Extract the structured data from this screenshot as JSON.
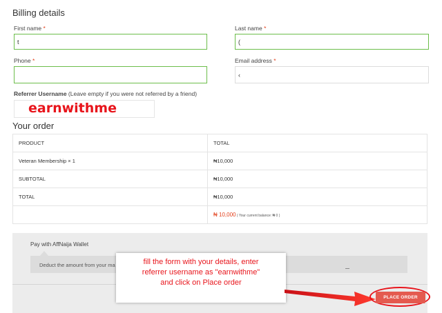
{
  "billing": {
    "title": "Billing details",
    "first_name": {
      "label": "First name",
      "required_mark": "*",
      "value": "t"
    },
    "last_name": {
      "label": "Last name",
      "required_mark": "*",
      "value": "("
    },
    "phone": {
      "label": "Phone",
      "required_mark": "*",
      "value": ""
    },
    "email": {
      "label": "Email address",
      "required_mark": "*",
      "value": "‹"
    },
    "referrer": {
      "label_bold": "Referrer Username",
      "label_hint": " (Leave empty if you were not referred by a friend)",
      "value": "earnwithme"
    }
  },
  "order": {
    "title": "Your order",
    "headers": [
      "PRODUCT",
      "TOTAL"
    ],
    "rows": [
      {
        "product": "Veteran Membership",
        "qty": " × 1",
        "total": "₦10,000"
      },
      {
        "product": "SUBTOTAL",
        "total": "₦10,000"
      },
      {
        "product": "TOTAL",
        "total": "₦10,000"
      }
    ],
    "wallet_total": "₦ 10,000",
    "wallet_balance": " ( Your current balance: ₦ 0 )"
  },
  "payment": {
    "method_label": "Pay with AffNaija Wallet",
    "description": "Deduct the amount from your ma",
    "place_order": "PLACE ORDER"
  },
  "callout": {
    "line1": "fill the form with your details, enter",
    "line2": "referrer username as \"earnwithme\"",
    "line3": "and click on Place order"
  },
  "colors": {
    "accent_red": "#e8141b",
    "field_border_green": "#6bbd49",
    "button": "#e45a4f"
  }
}
